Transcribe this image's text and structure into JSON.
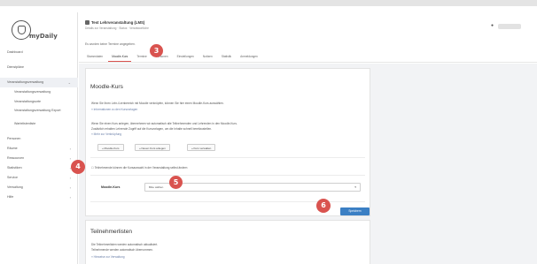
{
  "sidebar": {
    "logo_text": "myDaily",
    "items": [
      {
        "label": "Dashboard",
        "chev": ""
      },
      {
        "label": "Dienstpläne",
        "chev": ""
      },
      {
        "label": "Veranstaltungsverwaltung",
        "chev": "⌄"
      },
      {
        "label": "Veranstaltungsverwaltung",
        "chev": ""
      },
      {
        "label": "Veranstaltungsorte",
        "chev": ""
      },
      {
        "label": "Veranstaltungsverwaltung Export",
        "chev": ""
      },
      {
        "label": "Wartelistenliste",
        "chev": ""
      },
      {
        "label": "Personen",
        "chev": ""
      },
      {
        "label": "Räume",
        "chev": "›"
      },
      {
        "label": "Ressourcen",
        "chev": "›"
      },
      {
        "label": "Statistiken",
        "chev": "›"
      },
      {
        "label": "Service",
        "chev": "›"
      },
      {
        "label": "Verwaltung",
        "chev": "›"
      },
      {
        "label": "Hilfe",
        "chev": "›"
      }
    ]
  },
  "header": {
    "title": "Test Lehrveranstaltung (LMS)",
    "subtitle": "Details zur Veranstaltung · Status · Verantwortliche",
    "note": "Es wurden keine Termine angegeben.",
    "tabs": [
      "Stammdaten",
      "Moodle-Kurs",
      "Termine",
      "Personen",
      "Einstellungen",
      "Notizen",
      "Statistik",
      "Anmeldungen"
    ],
    "active_tab_index": 1,
    "user_icon": "user-icon"
  },
  "moodle_card": {
    "title": "Moodle-Kurs",
    "intro_line1": "Wenn Sie Ihren Lehr-/Lernbereich mit Moodle verknüpfen, können Sie hier einen Moodle-Kurs auswählen.",
    "intro_link": "» Informationen zu den Kursvorlagen",
    "para_line1": "Wenn Sie einen Kurs anlegen, übernehmen wir automatisch alle Teilnehmenden und Lehrenden in den Moodle-Kurs.",
    "para_line2": "Zusätzlich erhalten Lehrende Zugriff auf die Kursvorlagen, um die Inhalte schnell bereitzustellen.",
    "para_link": "» Mehr zur Verknüpfung",
    "buttons": [
      "» Moodle-Kurs",
      "» Neuen Kurs anlegen",
      "» Kurs verwalten"
    ],
    "checkbox_text": "Teilnehmende können die Kursauswahl in der Veranstaltung selbst ändern",
    "select_label": "Moodle-Kurs",
    "select_value": "Bitte wählen",
    "submit_label": "Speichern"
  },
  "second_card": {
    "title": "Teilnehmerlisten",
    "line1": "Die Teilnehmerlisten werden automatisch aktualisiert.",
    "line2": "Teilnehmende werden automatisch übernommen.",
    "link": "» Hinweise zur Verwaltung"
  },
  "callouts": [
    "3",
    "4",
    "5",
    "6"
  ],
  "colors": {
    "accent": "#d9534f",
    "primary": "#3b7fc4"
  }
}
